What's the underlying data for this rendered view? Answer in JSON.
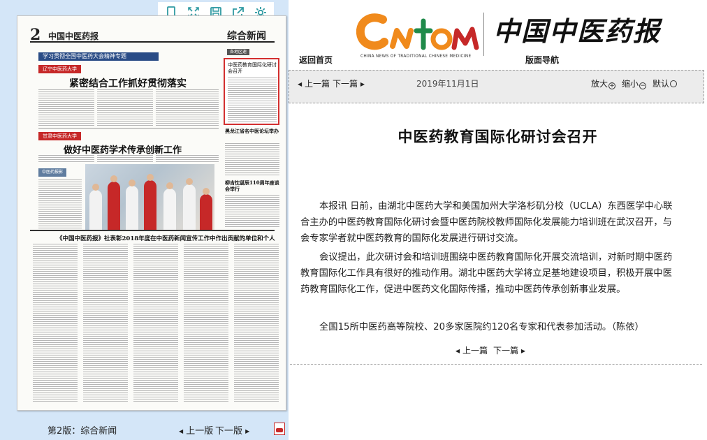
{
  "left_panel": {
    "toolbar": {
      "icons": [
        "document-icon",
        "fullscreen-icon",
        "save-icon",
        "share-icon",
        "settings-icon"
      ]
    },
    "newspaper": {
      "page_number": "2",
      "brand": "中国中医药报",
      "section": "综合新闻",
      "banner": "学习贯彻全国中医药大会精神专题",
      "story1_tag": "辽宁中医药大学",
      "story1_headline": "紧密结合工作抓好贯彻落实",
      "story2_tag": "甘肃中医药大学",
      "story2_headline": "做好中医药学术传承创新工作",
      "side_label": "各地区速",
      "side_title": "中医药教育国际化研讨会召开",
      "side_headline_2": "黑龙江省名中医论坛举办",
      "side_headline_3": "柳吉忱诞辰110周年座谈会举行",
      "photo_caption_pill": "中医药报影",
      "bottom_title": "《中国中医药报》社表彰2018年度在中医药新闻宣传工作中作出贡献的单位和个人"
    },
    "edition_label": "第2版：综合新闻",
    "prev_edition": "上一版",
    "next_edition": "下一版"
  },
  "header": {
    "logo_text": "中国中医药报",
    "logo_subtitle": "CHINA NEWS OF TRADITIONAL CHINESE MEDICINE",
    "nav_home": "返回首页",
    "nav_layout": "版面导航"
  },
  "nav_bar": {
    "prev_article": "上一篇",
    "next_article": "下一篇",
    "date": "2019年11月1日",
    "zoom_in": "放大",
    "zoom_out": "缩小",
    "zoom_default": "默认"
  },
  "article": {
    "title": "中医药教育国际化研讨会召开",
    "paragraphs": [
      "本报讯 日前，由湖北中医药大学和美国加州大学洛杉矶分校（UCLA）东西医学中心联合主办的中医药教育国际化研讨会暨中医药院校教师国际化发展能力培训班在武汉召开，与会专家学者就中医药教育的国际化发展进行研讨交流。",
      "会议提出，此次研讨会和培训班围绕中医药教育国际化开展交流培训，对新时期中医药教育国际化工作具有很好的推动作用。湖北中医药大学将立足基地建设项目，积极开展中医药教育国际化工作，促进中医药文化国际传播，推动中医药传承创新事业发展。",
      "全国15所中医药高等院校、20多家医院约120名专家和代表参加活动。（陈依）"
    ],
    "footer_prev": "上一篇",
    "footer_next": "下一篇"
  },
  "colors": {
    "left_background": "#d4e6f8",
    "highlight_border": "#d32f2f",
    "toolbar_icon": "#2f9aa2",
    "nav_bar_background": "#ececec"
  }
}
